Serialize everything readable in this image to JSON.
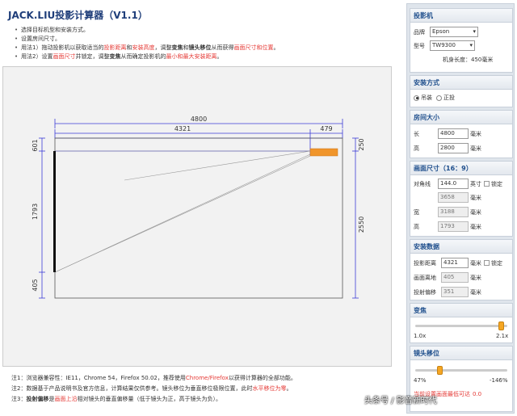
{
  "title": "JACK.LIU投影计算器（V1.1）",
  "instructions": {
    "l1": "选择目标机型和安装方式。",
    "l2": "设置房间尺寸。",
    "l3": {
      "a": "用法1）拖动投影机以获取适当的",
      "b": "投影距离",
      "c": "和",
      "d": "安装高度",
      "e": "，调整",
      "f": "变焦",
      "g": "和",
      "h": "镜头移位",
      "i": "从而获得",
      "j": "画面尺寸和位置",
      "k": "。"
    },
    "l4": {
      "a": "用法2）设置",
      "b": "画面尺寸",
      "c": "并锁定，调整",
      "d": "变焦",
      "e": "从而确定投影机的",
      "f": "最小和最大安装距离",
      "g": "。"
    }
  },
  "diagram": {
    "total_width": "4800",
    "screen_width": "4321",
    "projector_offset": "479",
    "top_margin_left": "601",
    "screen_height": "1793",
    "bottom_margin": "405",
    "top_margin_right": "250",
    "room_height": "2550"
  },
  "notes": {
    "n1": {
      "a": "注1：浏览器兼容性：IE11，Chrome 54，Firefox 50.02，推荐使用",
      "b": "Chrome/Firefox",
      "c": "以获得计算器的全部功能。"
    },
    "n2": {
      "a": "注2：数据基于产品说明书及官方信息，计算结果仅供参考。镜头移位为垂直移位极限位置，此时",
      "b": "水平移位为零",
      "c": "。"
    },
    "n3": {
      "a": "注3：",
      "b": "投射偏移",
      "c": "是",
      "d": "画面上沿",
      "e": "相对镜头的垂直偏移量（低于镜头为正，高于镜头为负）。"
    }
  },
  "sidebar": {
    "projector": {
      "header": "投影机",
      "brand_label": "品牌",
      "brand_value": "Epson",
      "model_label": "型号",
      "model_value": "TW9300",
      "length_text": "机身长度：450毫米"
    },
    "mount": {
      "header": "安装方式",
      "opt_ceiling": "吊装",
      "opt_floor": "正投"
    },
    "room": {
      "header": "房间大小",
      "length_label": "长",
      "length_value": "4800",
      "height_label": "高",
      "height_value": "2800",
      "unit": "毫米"
    },
    "screen": {
      "header": "画面尺寸（16：9）",
      "diag_label": "对角线",
      "diag_value": "144.0",
      "diag_unit": "英寸",
      "lock_label": "锁定",
      "diag_mm": "3658",
      "width_label": "宽",
      "width_value": "3188",
      "height_label": "高",
      "height_value": "1793",
      "unit": "毫米"
    },
    "install": {
      "header": "安装数据",
      "throw_label": "投影距离",
      "throw_value": "4321",
      "lock_label": "锁定",
      "floor_label": "画面离地",
      "floor_value": "405",
      "offset_label": "投射偏移",
      "offset_value": "351",
      "unit": "毫米"
    },
    "zoom": {
      "header": "变焦",
      "min": "1.0x",
      "max": "2.1x",
      "level_percent": 94
    },
    "shift": {
      "header": "镜头移位",
      "left": "47%",
      "right": "-146%",
      "level_percent": 27,
      "warn": "当前设置画面最低可达",
      "warn_value": "0.0"
    }
  },
  "watermark": "头条号 / 影音新时代"
}
